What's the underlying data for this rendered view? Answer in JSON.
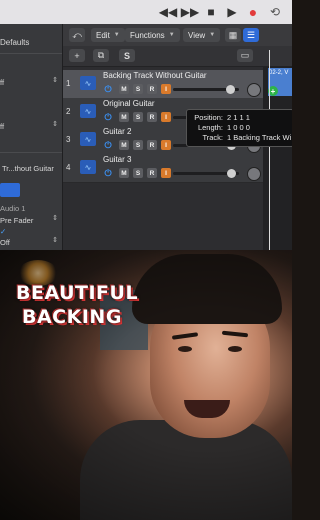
{
  "transport": {
    "buttons": [
      {
        "name": "rewind-icon",
        "glyph": "◀◀"
      },
      {
        "name": "fast-forward-icon",
        "glyph": "▶▶"
      },
      {
        "name": "stop-icon",
        "glyph": "■"
      },
      {
        "name": "play-icon",
        "glyph": "▶"
      },
      {
        "name": "record-icon",
        "glyph": "●"
      },
      {
        "name": "cycle-icon",
        "glyph": "⟲"
      }
    ]
  },
  "inspector": {
    "header": "Defaults",
    "row_off_1": "ff",
    "row_off_2": "ff",
    "region_name": "Tr...thout Guitar",
    "audio_label": "Audio 1",
    "pre_fader": "Pre Fader",
    "checkbox": "✓",
    "row_off_3": "Off"
  },
  "toolbar": {
    "back_icon": "⤺",
    "edit": "Edit",
    "functions": "Functions",
    "view": "View",
    "grid_icon": "▦",
    "list_icon": "☰"
  },
  "header2": {
    "add_icon": "+",
    "duplicate_icon": "⧉",
    "s_label": "S",
    "tab_icon": "▭"
  },
  "tracks": [
    {
      "number": "1",
      "name": "Backing Track Without Guitar",
      "selected": true,
      "fader": 0.88
    },
    {
      "number": "2",
      "name": "Original Guitar",
      "selected": false,
      "fader": 0.82
    },
    {
      "number": "3",
      "name": "Guitar 2",
      "selected": false,
      "fader": 0.9
    },
    {
      "number": "4",
      "name": "Guitar 3",
      "selected": false,
      "fader": 0.9
    }
  ],
  "track_controls": {
    "mute": "M",
    "solo": "S",
    "record": "R",
    "input": "I"
  },
  "region": {
    "label": "02-2, V"
  },
  "tooltip": {
    "position_key": "Position:",
    "position_val": "2 1 1 1",
    "length_key": "Length:",
    "length_val": "1 0 0 0",
    "track_key": "Track:",
    "track_val": "1  Backing Track Wi"
  },
  "video": {
    "caption_line1": "BEAUTIFUL",
    "caption_line2": "BACKING"
  },
  "colors": {
    "accent": "#2f6bd8",
    "record": "#e23b3b",
    "input": "#d97a2b",
    "caption_outline": "#e03838"
  }
}
